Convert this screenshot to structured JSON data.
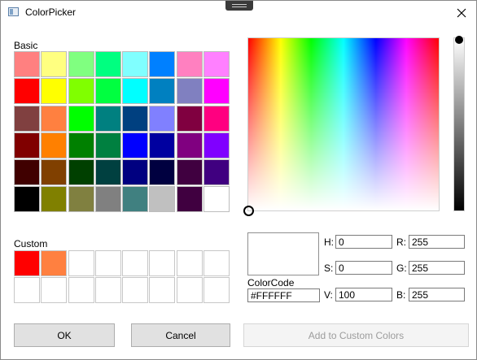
{
  "window": {
    "title": "ColorPicker",
    "icons": {
      "app": "app-window-icon",
      "close": "close-icon",
      "grip": "drag-grip-icon"
    }
  },
  "basic": {
    "label": "Basic",
    "colors": [
      "#ff8080",
      "#ffff80",
      "#80ff80",
      "#00ff80",
      "#80ffff",
      "#0080ff",
      "#ff80c0",
      "#ff80ff",
      "#ff0000",
      "#ffff00",
      "#80ff00",
      "#00ff40",
      "#00ffff",
      "#0080c0",
      "#8080c0",
      "#ff00ff",
      "#804040",
      "#ff8040",
      "#00ff00",
      "#008080",
      "#004080",
      "#8080ff",
      "#800040",
      "#ff0080",
      "#800000",
      "#ff8000",
      "#008000",
      "#008040",
      "#0000ff",
      "#0000a0",
      "#800080",
      "#8000ff",
      "#400000",
      "#804000",
      "#004000",
      "#004040",
      "#000080",
      "#000040",
      "#400040",
      "#400080",
      "#000000",
      "#808000",
      "#808040",
      "#808080",
      "#408080",
      "#c0c0c0",
      "#400040",
      "#ffffff"
    ]
  },
  "custom": {
    "label": "Custom",
    "colors": [
      "#ff0000",
      "#ff8040",
      "#ffffff",
      "#ffffff",
      "#ffffff",
      "#ffffff",
      "#ffffff",
      "#ffffff",
      "#ffffff",
      "#ffffff",
      "#ffffff",
      "#ffffff",
      "#ffffff",
      "#ffffff",
      "#ffffff",
      "#ffffff"
    ]
  },
  "preview": {
    "color": "#FFFFFF"
  },
  "colorcode": {
    "label": "ColorCode",
    "value": "#FFFFFF"
  },
  "hsv": {
    "h_label": "H:",
    "h_value": "0",
    "s_label": "S:",
    "s_value": "0",
    "v_label": "V:",
    "v_value": "100"
  },
  "rgb": {
    "r_label": "R:",
    "r_value": "255",
    "g_label": "G:",
    "g_value": "255",
    "b_label": "B:",
    "b_value": "255"
  },
  "buttons": {
    "ok": "OK",
    "cancel": "Cancel",
    "add_custom": "Add to Custom Colors"
  }
}
